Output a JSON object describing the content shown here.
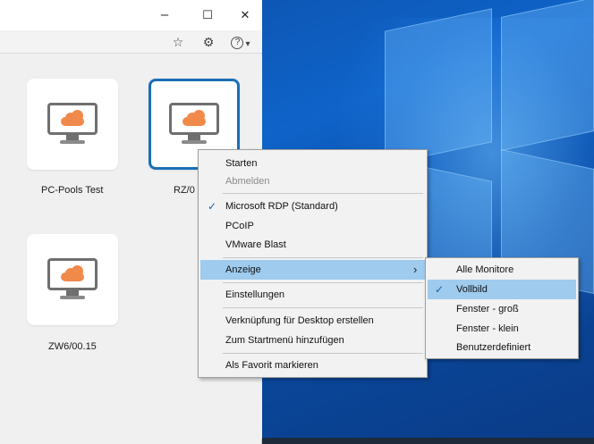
{
  "window": {
    "controls": {
      "minimize": "–",
      "maximize": "☐",
      "close": "✕"
    },
    "toolbar": {
      "favorite_icon": "star-icon",
      "settings_icon": "gear-icon",
      "help_icon": "help-icon"
    }
  },
  "tiles": [
    {
      "label": "PC-Pools Test",
      "selected": false
    },
    {
      "label": "RZ/0",
      "selected": true
    },
    {
      "label": "ZW6/00.15",
      "selected": false
    }
  ],
  "context_menu": {
    "items": {
      "start": "Starten",
      "logout": "Abmelden",
      "rdp": "Microsoft RDP (Standard)",
      "pcoip": "PCoIP",
      "blast": "VMware Blast",
      "display": "Anzeige",
      "settings": "Einstellungen",
      "shortcut": "Verknüpfung für Desktop erstellen",
      "startmenu": "Zum Startmenü hinzufügen",
      "favorite": "Als Favorit markieren"
    },
    "checked_protocol": "Microsoft RDP (Standard)"
  },
  "display_submenu": {
    "items": {
      "all_monitors": "Alle Monitore",
      "fullscreen": "Vollbild",
      "window_large": "Fenster - groß",
      "window_small": "Fenster - klein",
      "custom": "Benutzerdefiniert"
    },
    "checked": "Vollbild"
  },
  "colors": {
    "accent": "#1b6fb7",
    "highlight": "#9fcbee",
    "cloud": "#f08a4b"
  },
  "glyphs": {
    "check": "✓",
    "submenu_arrow": "›",
    "star": "☆",
    "gear": "⚙",
    "help": "?",
    "dropdown": "▾"
  }
}
